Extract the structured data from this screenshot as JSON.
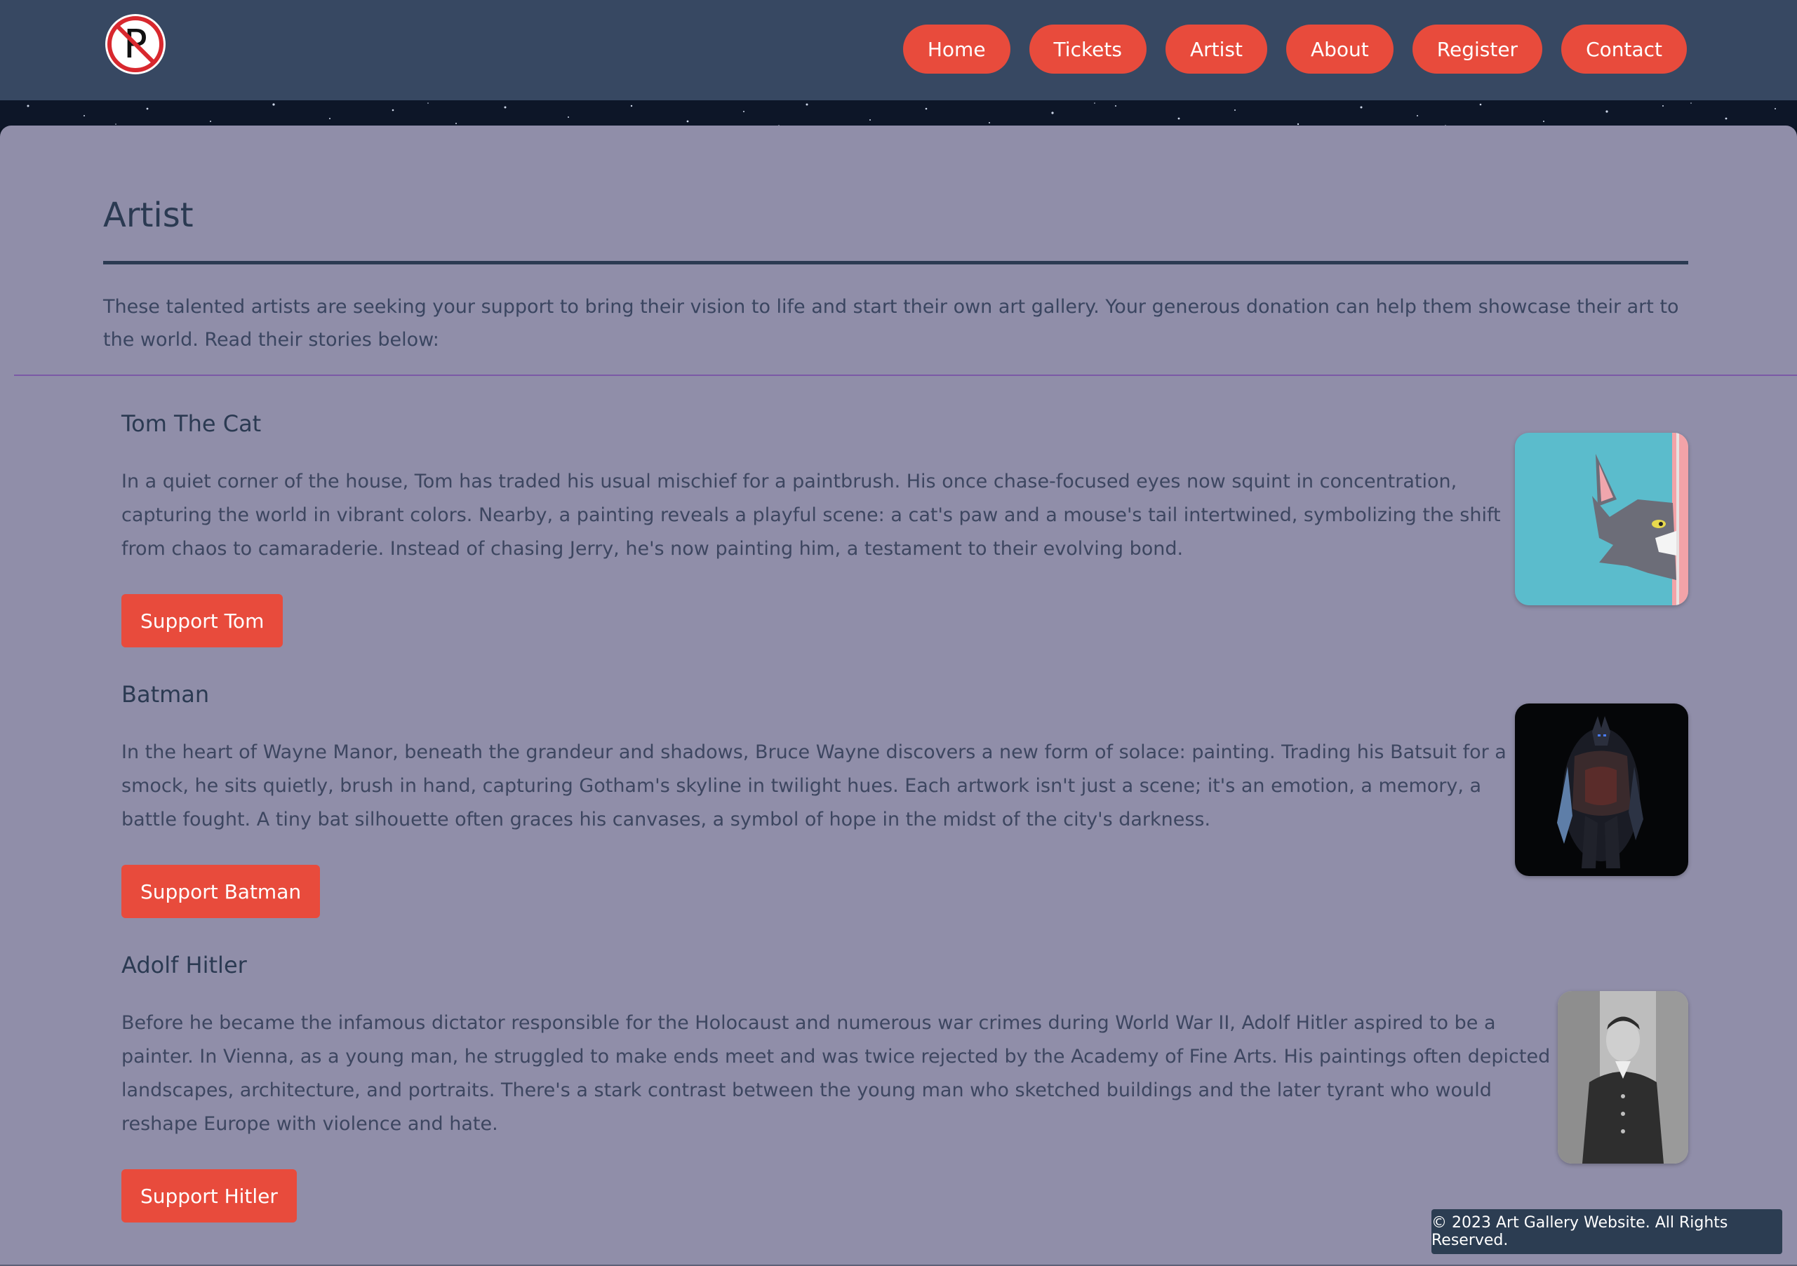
{
  "header": {
    "logo_icon": "no-parking-icon",
    "nav": [
      "Home",
      "Tickets",
      "Artist",
      "About",
      "Register",
      "Contact"
    ]
  },
  "page": {
    "title": "Artist",
    "intro": "These talented artists are seeking your support to bring their vision to life and start their own art gallery. Your generous donation can help them showcase their art to the world. Read their stories below:"
  },
  "artists": [
    {
      "name": "Tom The Cat",
      "story": "In a quiet corner of the house, Tom has traded his usual mischief for a paintbrush. His once chase-focused eyes now squint in concentration, capturing the world in vibrant colors. Nearby, a painting reveals a playful scene: a cat's paw and a mouse's tail intertwined, symbolizing the shift from chaos to camaraderie. Instead of chasing Jerry, he's now painting him, a testament to their evolving bond.",
      "button": "Support Tom"
    },
    {
      "name": "Batman",
      "story": "In the heart of Wayne Manor, beneath the grandeur and shadows, Bruce Wayne discovers a new form of solace: painting. Trading his Batsuit for a smock, he sits quietly, brush in hand, capturing Gotham's skyline in twilight hues. Each artwork isn't just a scene; it's an emotion, a memory, a battle fought. A tiny bat silhouette often graces his canvases, a symbol of hope in the midst of the city's darkness.",
      "button": "Support Batman"
    },
    {
      "name": "Adolf Hitler",
      "story": "Before he became the infamous dictator responsible for the Holocaust and numerous war crimes during World War II, Adolf Hitler aspired to be a painter. In Vienna, as a young man, he struggled to make ends meet and was twice rejected by the Academy of Fine Arts. His paintings often depicted landscapes, architecture, and portraits. There's a stark contrast between the young man who sketched buildings and the later tyrant who would reshape Europe with violence and hate.",
      "button": "Support Hitler"
    }
  ],
  "footer": {
    "text": "© 2023 Art Gallery Website. All Rights Reserved."
  },
  "colors": {
    "header_bg": "#374862",
    "main_bg": "#908ea9",
    "accent": "#e84b3c",
    "heading": "#2b3a52"
  }
}
